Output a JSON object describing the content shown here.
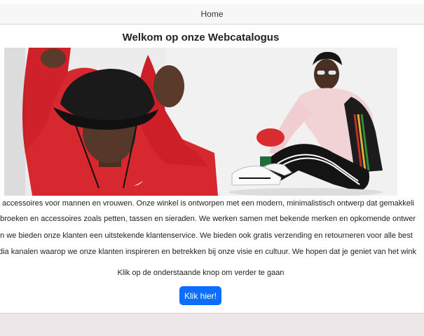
{
  "nav": {
    "home_label": "Home"
  },
  "main": {
    "title": "Welkom op onze Webcatalogus",
    "paragraphs": [
      "n accessoires voor mannen en vrouwen. Onze winkel is ontworpen met een modern, minimalistisch ontwerp dat gemakkeli",
      ", broeken en accessoires zoals petten, tassen en sieraden. We werken samen met bekende merken en opkomende ontwer",
      "en we bieden onze klanten een uitstekende klantenservice. We bieden ook gratis verzending en retourneren voor alle best",
      "dia kanalen waarop we onze klanten inspireren en betrekken bij onze visie en cultuur. We hopen dat je geniet van het wink"
    ],
    "cta_text": "Klik op de onderstaande knop om verder te gaan",
    "cta_button": "Klik hier!"
  },
  "colors": {
    "accent": "#0d6efd",
    "page_background": "#ece6e8",
    "navbar": "#f7f7f8"
  }
}
